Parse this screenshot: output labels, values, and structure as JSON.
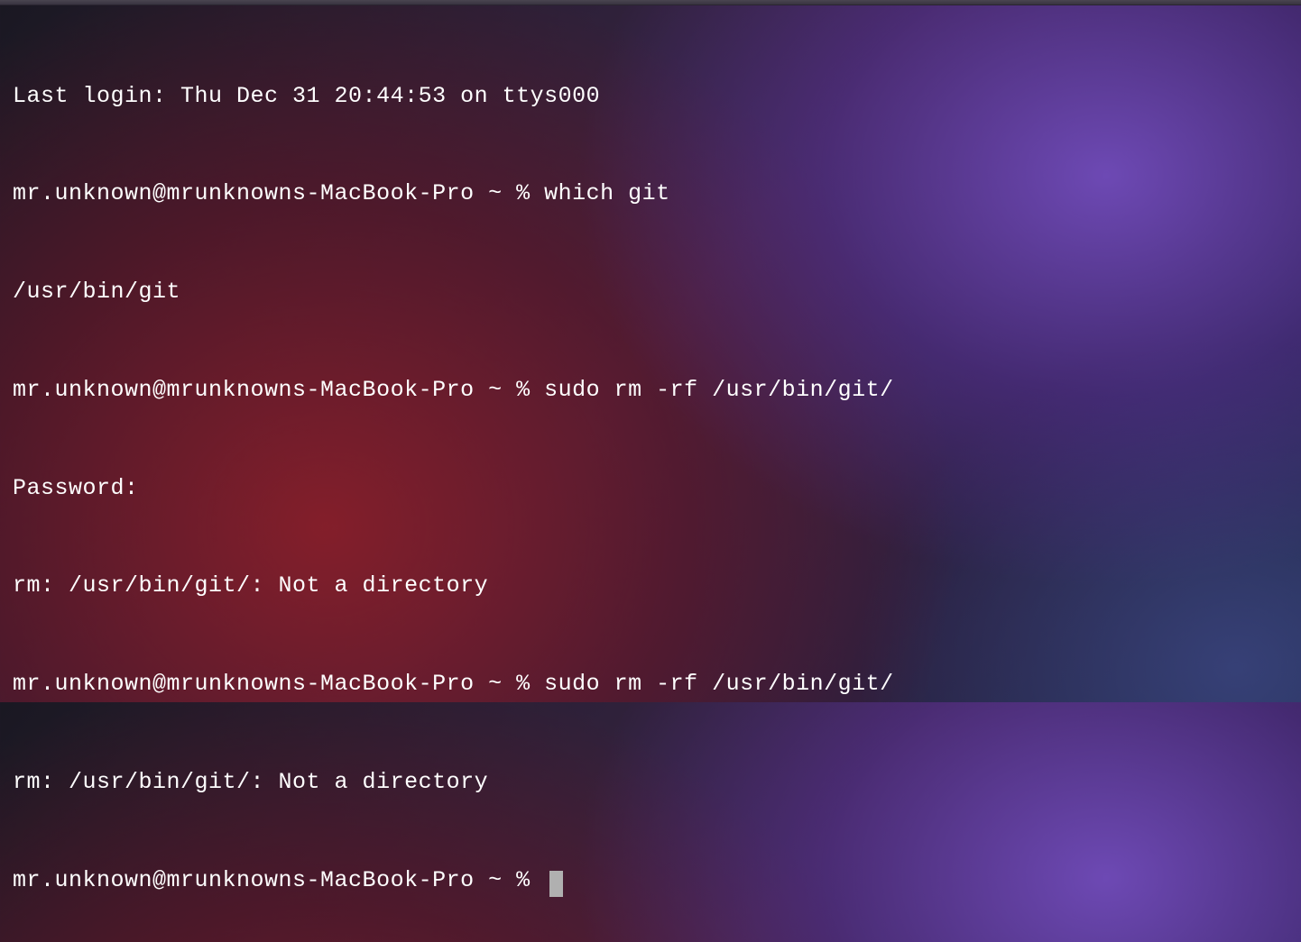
{
  "terminal": {
    "lines": [
      {
        "text": "Last login: Thu Dec 31 20:44:53 on ttys000",
        "type": "output"
      },
      {
        "prompt": "mr.unknown@mrunknowns-MacBook-Pro ~ % ",
        "command": "which git",
        "type": "prompt"
      },
      {
        "text": "/usr/bin/git",
        "type": "output"
      },
      {
        "prompt": "mr.unknown@mrunknowns-MacBook-Pro ~ % ",
        "command": "sudo rm -rf /usr/bin/git/",
        "type": "prompt"
      },
      {
        "text": "Password:",
        "type": "output"
      },
      {
        "text": "rm: /usr/bin/git/: Not a directory",
        "type": "output"
      },
      {
        "prompt": "mr.unknown@mrunknowns-MacBook-Pro ~ % ",
        "command": "sudo rm -rf /usr/bin/git/",
        "type": "prompt"
      },
      {
        "text": "rm: /usr/bin/git/: Not a directory",
        "type": "output"
      },
      {
        "prompt": "mr.unknown@mrunknowns-MacBook-Pro ~ % ",
        "command": "",
        "type": "prompt",
        "cursor": true
      }
    ]
  }
}
